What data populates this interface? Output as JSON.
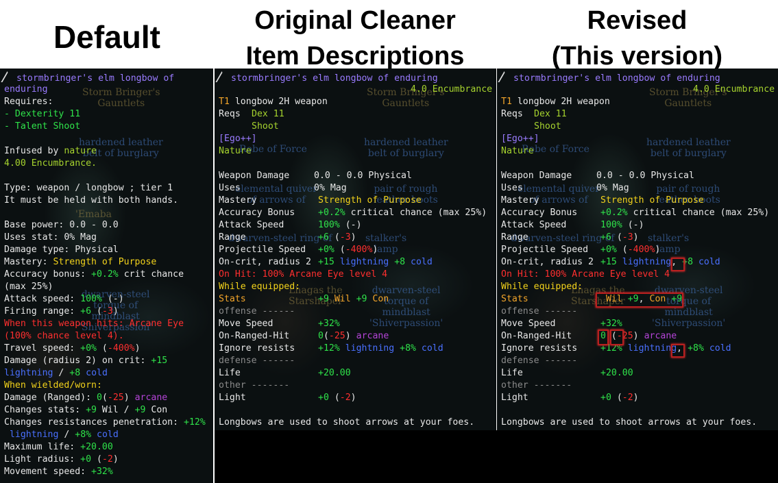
{
  "headings": {
    "default": "Default",
    "original_line1": "Original Cleaner",
    "original_line2": "Item Descriptions",
    "revised_line1": "Revised",
    "revised_line2": "(This version)"
  },
  "ghost_labels": {
    "gauntlets": "Storm Bringer's\nGauntlets",
    "belt": "hardened leather\nbelt of burglary",
    "robe": "Robe of Force",
    "quiver": "elemental quiver\nof arrows of",
    "boots": "pair of rough\nleather boots",
    "ring": "dwarven-steel ring of",
    "stalker": "stalker's\nlamp",
    "torque": "dwarven-steel\ntorque of\nmindblast\n'Shiverpassion'",
    "lhagas": "Lhagas the\nStarshaper",
    "emaba": "'Emaba"
  },
  "default_panel": {
    "name_line1": "stormbringer's elm longbow of",
    "name_line2": "enduring",
    "requires": "Requires:",
    "req_dex": "- Dexterity 11",
    "req_talent": "- Talent Shoot",
    "infused_prefix": "Infused by ",
    "infused_value": "nature",
    "encumbrance": "4.00 Encumbrance.",
    "type": "Type: weapon / longbow ; tier 1",
    "hands": "It must be held with both hands.",
    "base_power": "Base power: 0.0 - 0.0",
    "uses_stat": "Uses stat: 0% Mag",
    "damage_type": "Damage type: Physical",
    "mastery_label": "Mastery: ",
    "mastery_value": "Strength of Purpose",
    "accuracy_label": "Accuracy bonus: ",
    "accuracy_value": "+0.2%",
    "accuracy_rest": " crit chance",
    "accuracy_max": "(max 25%)",
    "attack_label": "Attack speed: ",
    "attack_value": "100%",
    "attack_rest": " (-)",
    "firing_label": "Firing range: ",
    "firing_value": "+6",
    "firing_open": " (",
    "firing_neg": "-3",
    "firing_close": ")",
    "onhit1": "When this weapon hits: Arcane Eye",
    "onhit2": "(100% chance level 4).",
    "travel_label": "Travel speed: ",
    "travel_value": "+0%",
    "travel_open": " (",
    "travel_neg": "-400%",
    "travel_close": ")",
    "crit_label": "Damage (radius 2) on crit: ",
    "crit_value": "+15",
    "crit_lightning": "lightning",
    "crit_sep": " / ",
    "crit_cold_value": "+8",
    "crit_cold": " cold",
    "wielded": "When wielded/worn:",
    "dmg_ranged_label": "Damage (Ranged): ",
    "dmg_ranged_value": "0",
    "dmg_ranged_open": "(",
    "dmg_ranged_neg": "-25",
    "dmg_ranged_close": ") ",
    "dmg_ranged_type": "arcane",
    "stats_label": "Changes stats: ",
    "stats_wil": "+9",
    "stats_wil_name": " Wil / ",
    "stats_con": "+9",
    "stats_con_name": " Con",
    "resist_label": "Changes resistances penetration: ",
    "resist_value": "+12%",
    "resist_lightning": "lightning",
    "resist_sep": " / ",
    "resist_cold_value": "+8%",
    "resist_cold": " cold",
    "life_label": "Maximum life: ",
    "life_value": "+20.00",
    "light_label": "Light radius: ",
    "light_value": "+0",
    "light_open": " (",
    "light_neg": "-2",
    "light_close": ")",
    "move_label": "Movement speed: ",
    "move_value": "+32%"
  },
  "clean_panel": {
    "name": "stormbringer's elm longbow of enduring",
    "encumbrance": "4.0 Encumbrance",
    "tier": "T1",
    "type": " longbow 2H weapon",
    "reqs": "Reqs",
    "req_dex": "Dex 11",
    "req_shoot": "Shoot",
    "ego": "[Ego++]",
    "nature": "Nature",
    "weapon_damage_label": "Weapon Damage",
    "weapon_damage_value": "0.0 - 0.0 Physical",
    "uses_label": "Uses",
    "uses_value": "0% Mag",
    "mastery_label": "Mastery",
    "mastery_value": "Strength of Purpose",
    "accuracy_label": "Accuracy Bonus",
    "accuracy_value": "+0.2%",
    "accuracy_rest": " critical chance (max 25%)",
    "attack_label": "Attack Speed",
    "attack_value": "100%",
    "attack_rest": " (-)",
    "range_label": "Range",
    "range_value": "+6",
    "range_open": " (",
    "range_neg": "-3",
    "range_close": ")",
    "proj_label": "Projectile Speed",
    "proj_value": "+0%",
    "proj_open": " (",
    "proj_neg": "-400%",
    "proj_close": ")",
    "oncrit_label": "On-crit, radius 2",
    "oncrit_value": "+15",
    "oncrit_lightning": " lightning",
    "oncrit_cold_value": "+8",
    "oncrit_cold": " cold",
    "onhit": "On Hit: 100% Arcane Eye level 4",
    "while_equipped": "While equipped:",
    "stats_label": "Stats",
    "stats_wil": "+9",
    "stats_wil_name": " Wil ",
    "stats_con": "+9",
    "stats_con_name": " Con",
    "offense": "offense ------",
    "move_label": "Move Speed",
    "move_value": "+32%",
    "ranged_label": "On-Ranged-Hit",
    "ranged_value": "0",
    "ranged_open": "(",
    "ranged_neg": "-25",
    "ranged_close": ") ",
    "ranged_type": "arcane",
    "ignore_label": "Ignore resists",
    "ignore_value": "+12%",
    "ignore_lightning": " lightning",
    "ignore_cold_value": "+8%",
    "ignore_cold": " cold",
    "defense": "defense ------",
    "life_label": "Life",
    "life_value": "+20.00",
    "other": "other -------",
    "light_label": "Light",
    "light_value": "+0",
    "light_open": " (",
    "light_neg": "-2",
    "light_close": ")",
    "flavor": "Longbows are used to shoot arrows at your foes."
  },
  "revised_panel": {
    "stats_wil_name": " Wil",
    "stats_comma": ", ",
    "stats_con_name": "Con ",
    "ranged_value": "0",
    "ranged_open": " (",
    "oncrit_comma": ",",
    "ignore_comma": ","
  }
}
